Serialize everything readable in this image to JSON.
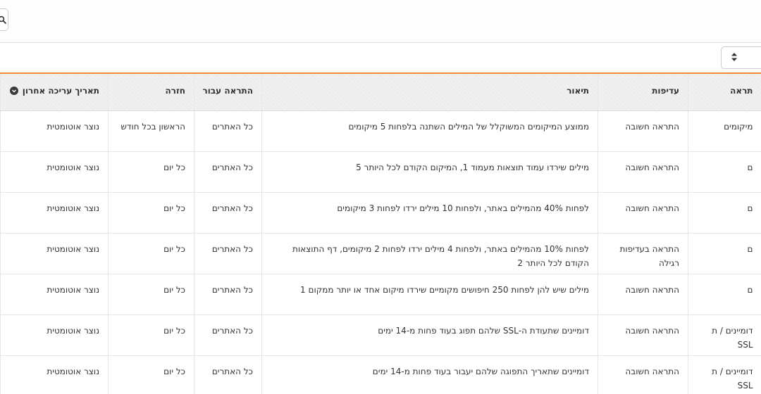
{
  "table": {
    "headers": {
      "type": "תראה",
      "priority": "עדיפות",
      "description": "תיאור",
      "alert_for": "התראה עבור",
      "recurrence": "חזרה",
      "last_edited": "תאריך עריכה אחרון"
    },
    "rows": [
      {
        "type": "מיקומים",
        "priority": "התראה חשובה",
        "description": "ממוצע המיקומים המשוקלל של המילים השתנה בלפחות 5 מיקומים",
        "alert_for": "כל האתרים",
        "recurrence": "הראשון בכל חודש",
        "last_edited": "נוצר אוטומטית"
      },
      {
        "type": "ם",
        "priority": "התראה חשובה",
        "description": "מילים שירדו עמוד תוצאות מעמוד 1, המיקום הקודם לכל היותר 5",
        "alert_for": "כל האתרים",
        "recurrence": "כל יום",
        "last_edited": "נוצר אוטומטית"
      },
      {
        "type": "ם",
        "priority": "התראה חשובה",
        "description": "לפחות 40% מהמילים באתר, ולפחות 10 מילים ירדו לפחות 3 מיקומים",
        "alert_for": "כל האתרים",
        "recurrence": "כל יום",
        "last_edited": "נוצר אוטומטית"
      },
      {
        "type": "ם",
        "priority": "התראה בעדיפות רגילה",
        "description": "לפחות 10% מהמילים באתר, ולפחות 4 מילים ירדו לפחות 2 מיקומים, דף התוצאות הקודם לכל היותר 2",
        "alert_for": "כל האתרים",
        "recurrence": "כל יום",
        "last_edited": "נוצר אוטומטית"
      },
      {
        "type": "ם",
        "priority": "התראה חשובה",
        "description": "מילים שיש להן לפחות 250 חיפושים מקומיים שירדו מיקום אחד או יותר ממקום 1",
        "alert_for": "כל האתרים",
        "recurrence": "כל יום",
        "last_edited": "נוצר אוטומטית"
      },
      {
        "type": "דומיינים / ת SSL",
        "priority": "התראה חשובה",
        "description": "דומיינים שתעודת ה-SSL שלהם תפוג בעוד פחות מ-14 ימים",
        "alert_for": "כל האתרים",
        "recurrence": "כל יום",
        "last_edited": "נוצר אוטומטית"
      },
      {
        "type": "דומיינים / ת SSL",
        "priority": "התראה חשובה",
        "description": "דומיינים שתאריך התפוגה שלהם יעבור בעוד פחות מ-14 ימים",
        "alert_for": "כל האתרים",
        "recurrence": "כל יום",
        "last_edited": "נוצר אוטומטית"
      }
    ]
  },
  "icons": {
    "search": "search-icon",
    "sort": "sort-arrows-icon",
    "header_sort": "chevron-down-circle-icon"
  },
  "colors": {
    "header_accent": "#f0883e"
  }
}
